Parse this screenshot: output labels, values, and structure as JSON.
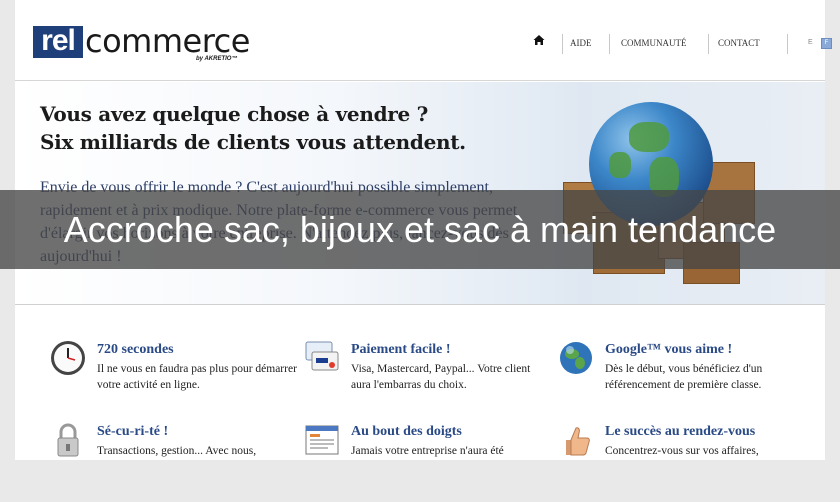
{
  "logo": {
    "box_text": "rel",
    "word": "commerce",
    "by": "by AKRETIO™"
  },
  "nav": {
    "home_icon": "home-icon",
    "items": [
      "AIDE",
      "COMMUNAUTÉ",
      "CONTACT"
    ],
    "lang": "E",
    "flag": "F"
  },
  "hero": {
    "title_line1": "Vous avez quelque chose à vendre ?",
    "title_line2": "Six milliards de clients vous attendent.",
    "body": "Envie de vous offrir le monde ? C'est aujourd'hui possible simplement, rapidement et à prix modique. Notre plate-forme e-commerce vous permet d'élargir vos horizons à votre entreprise. N'attendez plus, lancez-vous dès aujourd'hui !"
  },
  "overlay": {
    "text": "Accroche sac, bijoux et sac à main tendance"
  },
  "features": [
    {
      "icon": "clock-icon",
      "title": "720 secondes",
      "text": "Il ne vous en faudra pas plus pour démarrer votre activité en ligne."
    },
    {
      "icon": "payment-card-icon",
      "title": "Paiement facile !",
      "text": "Visa, Mastercard, Paypal... Votre client aura l'embarras du choix."
    },
    {
      "icon": "globe-icon",
      "title": "Google™ vous aime !",
      "text": "Dès le début, vous bénéficiez d'un référencement de première classe."
    },
    {
      "icon": "padlock-icon",
      "title": "Sé-cu-ri-té !",
      "text": "Transactions, gestion... Avec nous,"
    },
    {
      "icon": "browser-window-icon",
      "title": "Au bout des doigts",
      "text": "Jamais votre entreprise n'aura été"
    },
    {
      "icon": "thumbs-up-icon",
      "title": "Le succès au rendez-vous",
      "text": "Concentrez-vous sur vos affaires,"
    }
  ],
  "colors": {
    "brand_blue": "#1f3f7a",
    "feature_title": "#2a4a86",
    "hero_body": "#2d3e66"
  }
}
